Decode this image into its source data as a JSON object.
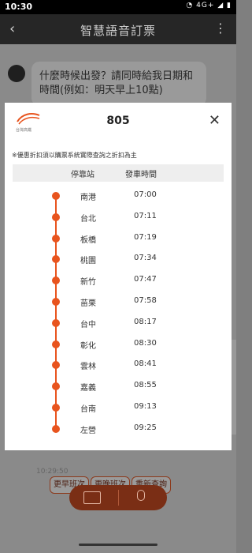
{
  "status": {
    "time": "10:30",
    "network": "4G+"
  },
  "appbar": {
    "title": "智慧語音訂票"
  },
  "chat": {
    "bot_message": "什麼時候出發？請同時給我日期和時間(例如：明天早上10點)",
    "timestamp": "10:29:50",
    "quick_replies": [
      "更早班次",
      "更晚班次",
      "重新查詢"
    ]
  },
  "modal": {
    "logo_label": "台灣高鐵",
    "train_no": "805",
    "note": "※優惠折扣須以購票系統實際查詢之折扣為主",
    "headers": {
      "station": "停靠站",
      "departure": "發車時間"
    },
    "stops": [
      {
        "station": "南港",
        "time": "07:00"
      },
      {
        "station": "台北",
        "time": "07:11"
      },
      {
        "station": "板橋",
        "time": "07:19"
      },
      {
        "station": "桃園",
        "time": "07:34"
      },
      {
        "station": "新竹",
        "time": "07:47"
      },
      {
        "station": "苗栗",
        "time": "07:58"
      },
      {
        "station": "台中",
        "time": "08:17"
      },
      {
        "station": "彰化",
        "time": "08:30"
      },
      {
        "station": "雲林",
        "time": "08:41"
      },
      {
        "station": "嘉義",
        "time": "08:55"
      },
      {
        "station": "台南",
        "time": "09:13"
      },
      {
        "station": "左營",
        "time": "09:25"
      }
    ]
  },
  "colors": {
    "accent": "#e8541e",
    "appbar": "#262626"
  }
}
